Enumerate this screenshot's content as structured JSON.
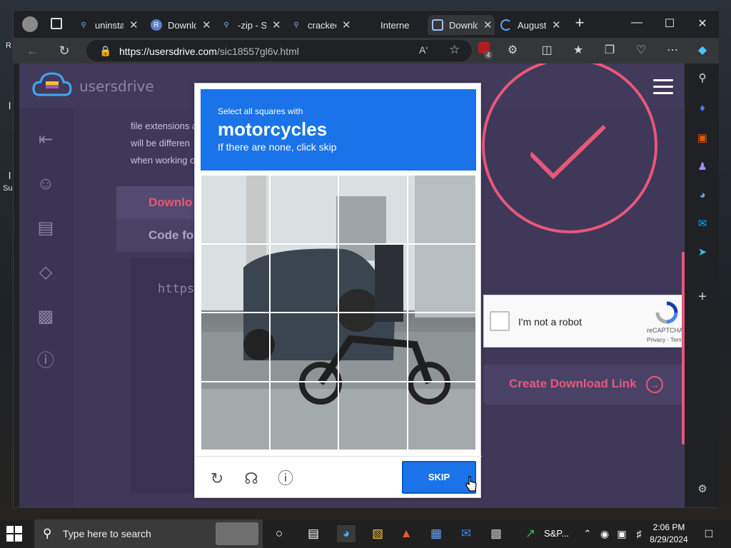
{
  "desktop": {
    "frag_r": "R",
    "frag_l1": "l",
    "frag_l2": "l",
    "frag_su": "Su"
  },
  "browser": {
    "tabs": [
      {
        "label": "uninsta",
        "icon": "search-favicon"
      },
      {
        "label": "Downlo",
        "icon": "r-favicon"
      },
      {
        "label": "-zip - S",
        "icon": "search-favicon"
      },
      {
        "label": "cracked",
        "icon": "search-favicon"
      },
      {
        "label": "Interne",
        "icon": "blank-favicon"
      },
      {
        "label": "Downlo",
        "icon": "usersdrive-favicon",
        "active": true
      },
      {
        "label": "August",
        "icon": "loading-favicon"
      }
    ],
    "new_tab": "+",
    "url_host": "https://usersdrive.com",
    "url_path": "/sic18557gl6v.html",
    "ublock_badge": "4"
  },
  "page": {
    "brand": "usersdrive",
    "paragraph_lines": [
      "file extensions a",
      "will be differen",
      "when working o"
    ],
    "download_tabs": [
      "Downlo",
      "Code fo"
    ],
    "url_fragment": "https:/",
    "recaptcha": {
      "label": "I'm not a robot",
      "brand": "reCAPTCHA",
      "links": "Privacy - Terms"
    },
    "create_link_label": "Create Download Link",
    "accent_color": "#e8577a"
  },
  "captcha": {
    "instruction": "Select all squares with",
    "target": "motorcycles",
    "hint": "If there are none, click skip",
    "skip_label": "SKIP",
    "grid_rows": 4,
    "grid_cols": 4
  },
  "taskbar": {
    "search_placeholder": "Type here to search",
    "stock_label": "S&P...",
    "time": "2:06 PM",
    "date": "8/29/2024"
  }
}
